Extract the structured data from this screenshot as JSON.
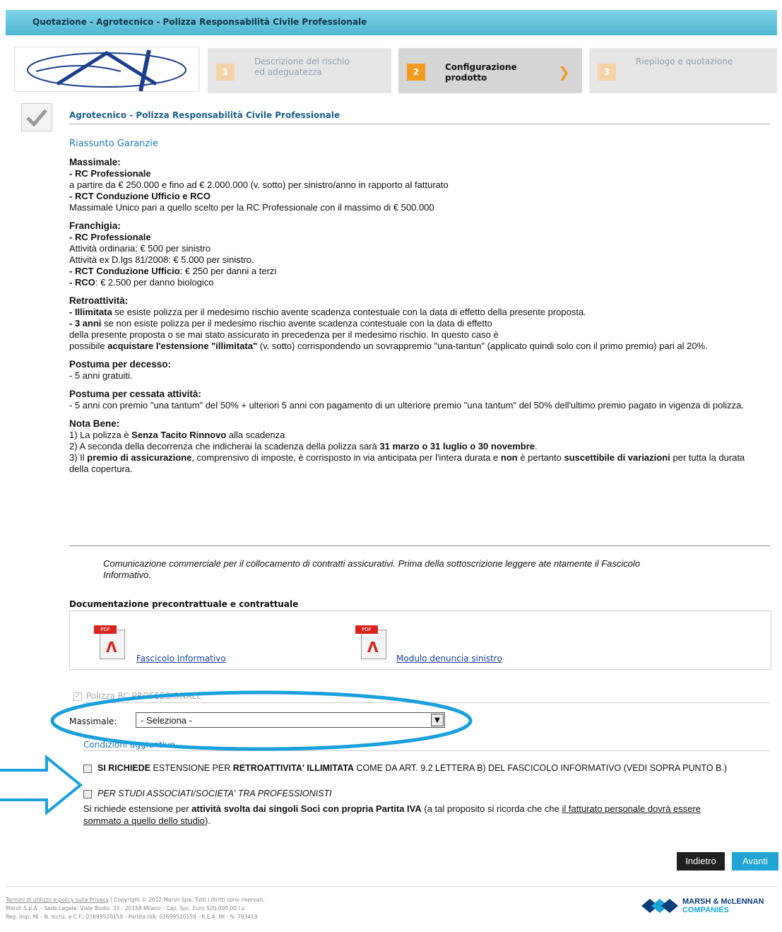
{
  "header": {
    "title": "Quotazione - Agrotecnico - Polizza Responsabilità Civile Professionale"
  },
  "steps": [
    {
      "num": "1",
      "label": "Descrizione del rischio ed adeguatezza"
    },
    {
      "num": "2",
      "label": "Configurazione prodotto"
    },
    {
      "num": "3",
      "label": "Riepilogo e quotazione"
    }
  ],
  "product_title": "Agrotecnico - Polizza Responsabilità Civile Professionale",
  "section": "Riassunto Garanzie",
  "massimale": {
    "title": "Massimale:",
    "l1": "- RC Professionale",
    "l2": "a partire da € 250.000 e fino ad € 2.000.000 (v. sotto) per sinistro/anno in rapporto al fatturato",
    "l3": "- RCT Conduzione Ufficio e RCO",
    "l4": "Massimale Unico pari a quello scelto per la RC Professionale con il massimo di € 500.000"
  },
  "franchigia": {
    "title": "Franchigia:",
    "l1": "- RC Professionale",
    "l2": "Attività ordinaria: € 500 per sinistro",
    "l3": "Attività ex D.lgs 81/2008: € 5.000 per sinistro.",
    "l4a": "- RCT Conduzione Ufficio",
    "l4b": ": € 250 per danni a terzi",
    "l5a": "- RCO",
    "l5b": ": € 2.500 per danno biologico"
  },
  "retro": {
    "title": "Retroattività:",
    "l1a": "- Illimitata",
    "l1b": " se esiste polizza per il medesimo rischio avente scadenza contestuale con la data di effetto della presente proposta.",
    "l2a": "- 3 anni",
    "l2b": " se non esiste polizza per il medesimo rischio avente scadenza contestuale con la data di effetto",
    "l3": "della presente proposta o se mai stato assicurato in precedenza per il medesimo rischio. In questo caso è",
    "l4a": "possibile ",
    "l4b": "acquistare l'estensione \"illimitata\"",
    "l4c": " (v. sotto) corrispondendo un sovrappremio \"una-tantun\" (applicato quindi solo con il primo premio) pari al 20%."
  },
  "decesso": {
    "title": "Postuma per decesso:",
    "l1": "- 5 anni gratuiti."
  },
  "cessata": {
    "title": "Postuma per cessata attività:",
    "l1": "- 5 anni con premio \"una tantum\" del 50% + ulteriori 5 anni con pagamento di un ulteriore premio \"una tantum\" del 50% dell'ultimo premio pagato in vigenza di polizza."
  },
  "nota": {
    "title": "Nota Bene:",
    "l1a": "1) La polizza è ",
    "l1b": "Senza Tacito Rinnovo",
    "l1c": " alla scadenza",
    "l2a": "2) A seconda della decorrenza che indicherai la scadenza della polizza sarà ",
    "l2b": "31 marzo o 31 luglio o 30 novembre",
    "l2c": ".",
    "l3a": "3) Il ",
    "l3b": "premio di assicurazione",
    "l3c": ", comprensivo di imposte, è corrisposto in via anticipata per l'intera durata e ",
    "l3d": "non",
    "l3e": " è pertanto ",
    "l3f": "suscettibile di variazioni",
    "l3g": " per tutta la durata della copertura."
  },
  "notice": "Comunicazione commerciale per il collocamento di contratti assicurativi. Prima della sottoscrizione leggere ate ntamente il Fascicolo Informativo.",
  "docs": {
    "title": "Documentazione precontrattuale e contrattuale",
    "pdf_tag": "PDF",
    "link1": "Fascicolo Informativo",
    "link2": "Modulo denuncia sinistro"
  },
  "polizza_label": "Polizza RC PROFESSIONALE",
  "form": {
    "massimale_label": "Massimale:",
    "select_value": "- Seleziona -",
    "cond_label": "Condizioni aggiuntive"
  },
  "options": {
    "o1a": "SI RICHIEDE",
    "o1b": " ESTENSIONE PER ",
    "o1c": "RETROATTIVITA' ILLIMITATA",
    "o1d": " COME DA ART. 9.2 LETTERA B) DEL FASCICOLO INFORMATIVO (VEDI SOPRA PUNTO B.)",
    "o2": "PER STUDI ASSOCIATI/SOCIETA' TRA PROFESSIONISTI",
    "o3a": "Si richiede estensione per ",
    "o3b": "attività svolta dai singoli Soci con propria Partita IVA",
    "o3c": " (a tal proposito si ricorda che che ",
    "o3d": "il fatturato personale dovrà essere sommato a quello dello studio",
    "o3e": ")."
  },
  "buttons": {
    "back": "Indietro",
    "next": "Avanti"
  },
  "footer": {
    "link1": "Termini di utilizzo e policy sulla Privacy",
    "copy": " | Copyright © 2012 Marsh Spa. Tutti i diritti sono riservati.",
    "l2": "Marsh S.p.A. - Sede Legale: Viale Bodio, 33 - 20158 Milano - Cap. Soc. Euro 520.000,00 i.v.",
    "l3": "Reg. Imp. MI - N. Iscriz. e C.F.: 01699520159 - Partita IVA: 01699520159 - R.E.A. MI - N. 793418"
  },
  "brand": {
    "l1": "MARSH & McLENNAN",
    "l2": "COMPANIES"
  },
  "colors": {
    "accent": "#21a5d4",
    "step_active": "#f39a1f",
    "annotation": "#1aa0dc"
  }
}
